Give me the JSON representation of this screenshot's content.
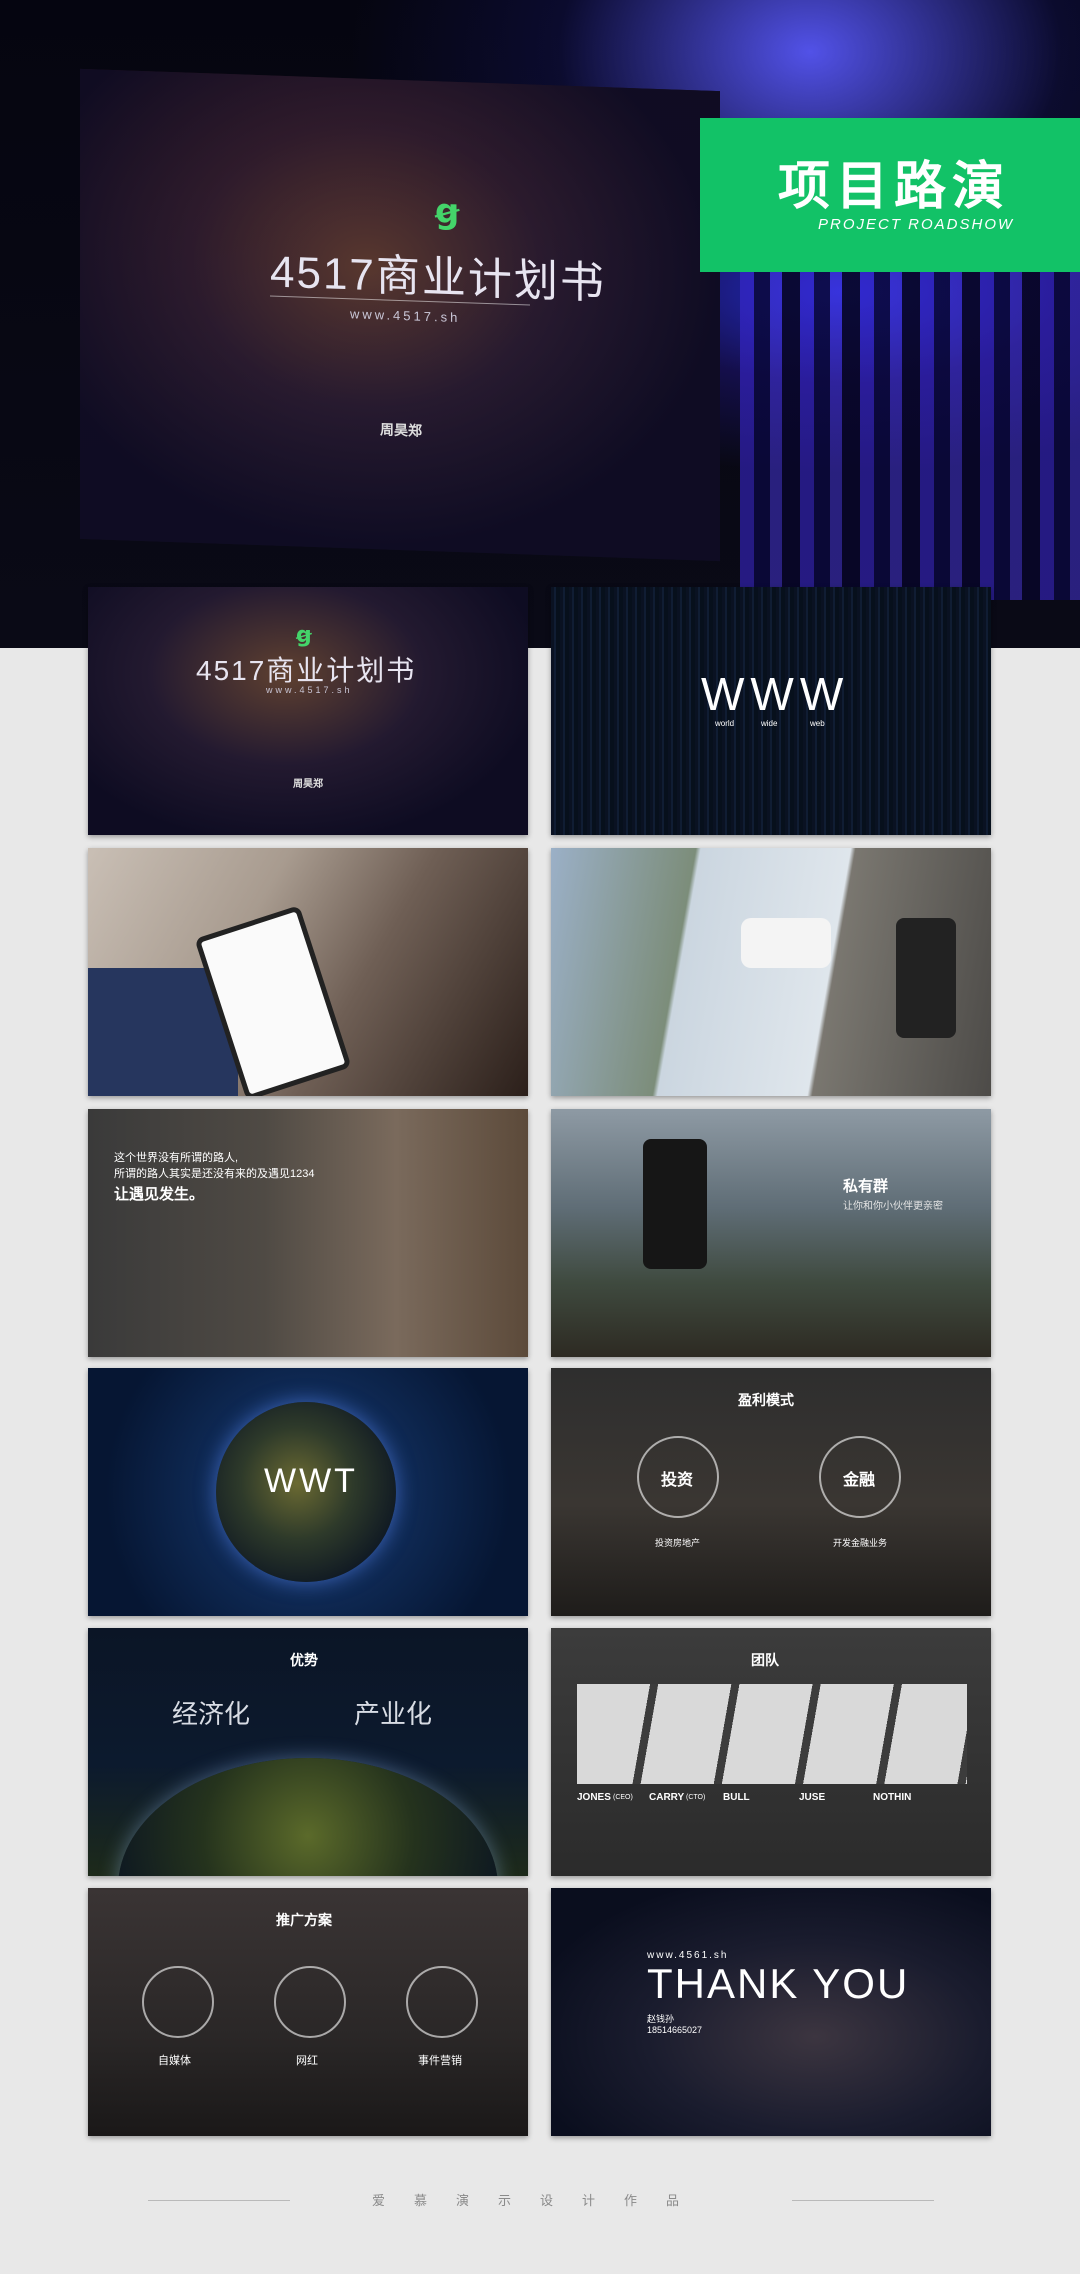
{
  "hero": {
    "logo": "ꞡ",
    "title": "4517商业计划书",
    "url": "www.4517.sh",
    "author": "周昊郑"
  },
  "badge": {
    "title": "项目路演",
    "subtitle": "PROJECT ROADSHOW",
    "color": "#12c267"
  },
  "slides": {
    "s1": {
      "logo": "ꞡ",
      "title": "4517商业计划书",
      "url": "www.4517.sh",
      "author": "周昊郑"
    },
    "s2": {
      "title": "WWW",
      "labels": [
        "world",
        "wide",
        "web"
      ]
    },
    "s5": {
      "line1": "这个世界没有所谓的路人,",
      "line2": "所谓的路人其实是还没有来的及遇见1234",
      "line3": "让遇见发生。"
    },
    "s6": {
      "title": "私有群",
      "subtitle": "让你和你小伙伴更亲密"
    },
    "s7": {
      "title": "WWT"
    },
    "s8": {
      "title": "盈利模式",
      "items": [
        {
          "label": "投资",
          "desc": "投资房地产"
        },
        {
          "label": "金融",
          "desc": "开发金融业务"
        }
      ]
    },
    "s9": {
      "title": "优势",
      "items": [
        "经济化",
        "产业化"
      ]
    },
    "s10": {
      "title": "团队",
      "members": [
        {
          "name": "JONES",
          "role": "(CEO)"
        },
        {
          "name": "CARRY",
          "role": "(CTO)"
        },
        {
          "name": "BULL",
          "role": ""
        },
        {
          "name": "JUSE",
          "role": ""
        },
        {
          "name": "NOTHIN",
          "role": ""
        }
      ]
    },
    "s11": {
      "title": "推广方案",
      "items": [
        "自媒体",
        "网红",
        "事件营销"
      ]
    },
    "s12": {
      "url": "www.4561.sh",
      "title": "THANK YOU",
      "name": "赵钱孙",
      "phone": "18514665027"
    }
  },
  "footer": {
    "text": "爱慕演示设计作品"
  }
}
